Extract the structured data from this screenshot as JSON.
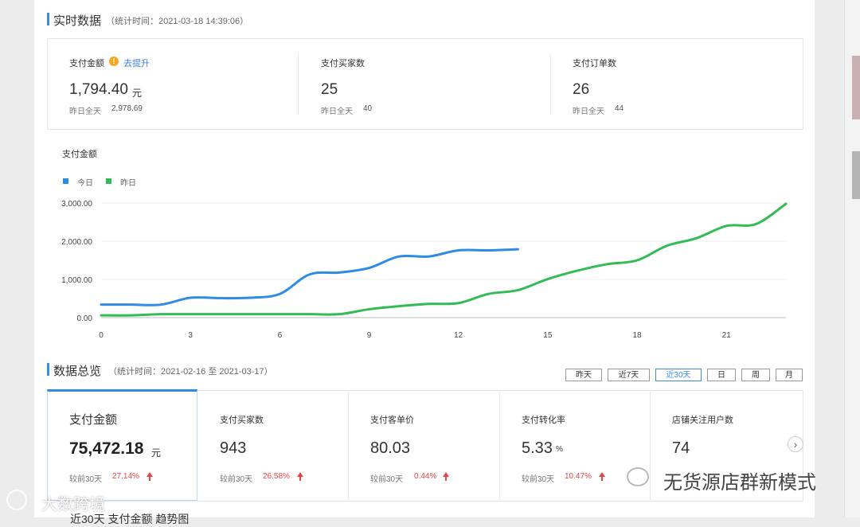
{
  "realtime": {
    "title": "实时数据",
    "subtitle": "（统计时间：2021-03-18 14:39:06）",
    "metrics": [
      {
        "label": "支付金额",
        "value": "1,794.40",
        "unit": "元",
        "yesterday_label": "昨日全天",
        "yesterday_value": "2,978.69",
        "link": "去提升"
      },
      {
        "label": "支付买家数",
        "value": "25",
        "unit": "",
        "yesterday_label": "昨日全天",
        "yesterday_value": "40"
      },
      {
        "label": "支付订单数",
        "value": "26",
        "unit": "",
        "yesterday_label": "昨日全天",
        "yesterday_value": "44"
      }
    ]
  },
  "chart_data": {
    "type": "line",
    "title": "支付金额",
    "xlabel": "",
    "ylabel": "",
    "xlim": [
      0,
      23
    ],
    "ylim": [
      0,
      3000
    ],
    "x_ticks": [
      0,
      3,
      6,
      9,
      12,
      15,
      18,
      21
    ],
    "y_ticks": [
      "3,000.00",
      "2,000.00",
      "1,000.00",
      "0.00"
    ],
    "y_tick_values": [
      3000,
      2000,
      1000,
      0
    ],
    "legend_position": "top-left",
    "series": [
      {
        "name": "今日",
        "color": "#2f8ce6",
        "x": [
          0,
          1,
          2,
          3,
          4,
          5,
          6,
          7,
          8,
          9,
          10,
          11,
          12,
          13,
          14
        ],
        "values": [
          340,
          340,
          340,
          520,
          510,
          520,
          620,
          1130,
          1180,
          1300,
          1600,
          1600,
          1760,
          1760,
          1790
        ]
      },
      {
        "name": "昨日",
        "color": "#33bb55",
        "x": [
          0,
          1,
          2,
          3,
          4,
          5,
          6,
          7,
          8,
          9,
          10,
          11,
          12,
          13,
          14,
          15,
          16,
          17,
          18,
          19,
          20,
          21,
          22,
          23
        ],
        "values": [
          60,
          60,
          90,
          90,
          90,
          90,
          90,
          90,
          90,
          220,
          300,
          360,
          380,
          620,
          720,
          1010,
          1230,
          1400,
          1500,
          1880,
          2080,
          2400,
          2450,
          2980
        ]
      }
    ]
  },
  "overview": {
    "title": "数据总览",
    "subtitle": "（统计时间：2021-02-16 至 2021-03-17）",
    "range_buttons": [
      "昨天",
      "近7天",
      "近30天",
      "日",
      "周",
      "月"
    ],
    "active_range": "近30天",
    "cards": [
      {
        "label": "支付金额",
        "value": "75,472.18",
        "unit": "元",
        "compare_label": "较前30天",
        "compare_value": "27.14%"
      },
      {
        "label": "支付买家数",
        "value": "943",
        "unit": "",
        "compare_label": "较前30天",
        "compare_value": "26.58%"
      },
      {
        "label": "支付客单价",
        "value": "80.03",
        "unit": "",
        "compare_label": "较前30天",
        "compare_value": "0.44%"
      },
      {
        "label": "支付转化率",
        "value": "5.33",
        "unit": "%",
        "compare_label": "较前30天",
        "compare_value": "10.47%"
      },
      {
        "label": "店铺关注用户数",
        "value": "74",
        "unit": "",
        "compare_label": "",
        "compare_value": ""
      }
    ],
    "next_label": "›",
    "bottom_title": "近30天 支付金额 趋势图"
  },
  "watermarks": {
    "left": "大数跨境",
    "right": "无货源店群新模式"
  }
}
